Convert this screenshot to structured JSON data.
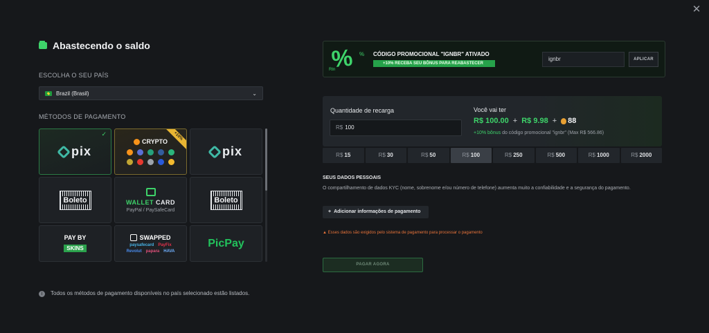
{
  "close_icon": "close-icon",
  "left": {
    "title": "Abastecendo o saldo",
    "country_label": "ESCOLHA O SEU PAÍS",
    "country_value": "Brazil (Brasil)",
    "methods_label": "MÉTODOS DE PAGAMENTO",
    "methods": {
      "pix": "pix",
      "crypto": "CRYPTO",
      "crypto_badge": "+10%",
      "boleto": "Boleto",
      "wallet_card_a": "WALLET",
      "wallet_card_b": "CARD",
      "wallet_card_sub": "PayPal / PaySafeCard",
      "paybyskins_a": "PAY BY",
      "paybyskins_b": "SKINS",
      "swapped": "SWAPPED",
      "swapped_row1": [
        "paysafecard",
        "PayFix"
      ],
      "swapped_row2": [
        "Revolut",
        "papara",
        "HAVA"
      ],
      "picpay": "PicPay"
    },
    "note": "Todos os métodos de pagamento disponíveis no país selecionado estão listados."
  },
  "promo": {
    "big": "%",
    "small_pct": "%",
    "small_label": "Rtn",
    "title": "CÓDIGO PROMOCIONAL \"IGNBR\" ATIVADO",
    "badge": "+10% RECEBA SEU BÔNUS PARA REABASTECER",
    "input_value": "ignbr",
    "apply": "APLICAR"
  },
  "recharge": {
    "label": "Quantidade de recarga",
    "currency": "R$",
    "value": "100",
    "you_get_label": "Você vai ter",
    "amount": "R$ 100.00",
    "plus1": "+",
    "bonus": "R$ 9.98",
    "plus2": "+",
    "coins": "88",
    "bonus_highlight": "+10% bônus",
    "bonus_rest": " do código promocional \"ignbr\" (Max R$ 566.86)"
  },
  "amounts": [
    "15",
    "30",
    "50",
    "100",
    "250",
    "500",
    "1000",
    "2000"
  ],
  "amount_currency": "R$",
  "active_amount": "100",
  "kyc": {
    "title": "SEUS DADOS PESSOAIS",
    "description": "O compartilhamento de dados KYC (nome, sobrenome e/ou número de telefone) aumenta muito a confiabilidade e a segurança do pagamento.",
    "button_plus": "+",
    "button": "Adicionar informações de pagamento",
    "warning": "Esses dados são exigidos pelo sistema de pagamento para processar o pagamento"
  },
  "pay_button": "PAGAR AGORA",
  "colors": {
    "accent": "#3ed36a",
    "warning": "#e8733a",
    "bg": "#16181b"
  }
}
